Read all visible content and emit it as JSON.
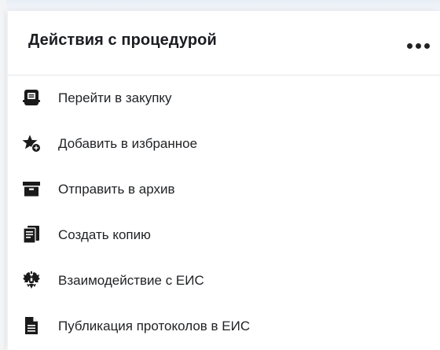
{
  "panel": {
    "title": "Действия с процедурой",
    "more_icon": "more-horizontal-icon"
  },
  "menu": {
    "items": [
      {
        "label": "Перейти в закупку",
        "icon": "document-card-icon"
      },
      {
        "label": "Добавить в избранное",
        "icon": "star-add-icon"
      },
      {
        "label": "Отправить в архив",
        "icon": "archive-icon"
      },
      {
        "label": "Создать копию",
        "icon": "copy-document-icon"
      },
      {
        "label": "Взаимодействие с ЕИС",
        "icon": "coat-of-arms-icon"
      },
      {
        "label": "Публикация протоколов в ЕИС",
        "icon": "file-text-icon"
      }
    ]
  },
  "colors": {
    "text": "#1f2124",
    "icon": "#1a1a1a",
    "divider": "#e3e5e8"
  }
}
